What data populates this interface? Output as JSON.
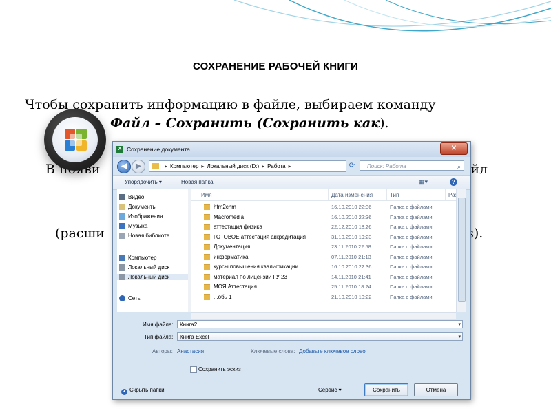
{
  "slide": {
    "title": "СОХРАНЕНИЕ РАБОЧЕЙ КНИГИ",
    "line1": "Чтобы сохранить информацию в файле, выбираем команду",
    "line2_emph": "Файл – Сохранить (Сохранить как",
    "line2_tail": ").",
    "line3_left": "В появи",
    "line3_right": "айл",
    "line4_left": "(расши",
    "line4_right": "ls)."
  },
  "dialog": {
    "title": "Сохранение документа",
    "close_icon": "✕",
    "path": [
      "Компьютер",
      "Локальный диск (D:)",
      "Работа"
    ],
    "search_placeholder": "Поиск: Работа",
    "toolbar": {
      "organize": "Упорядочить ▾",
      "new_folder": "Новая папка"
    },
    "nav_items": [
      "Видео",
      "Документы",
      "Изображения",
      "Музыка",
      "Новая библиоте",
      "Компьютер",
      "Локальный диск",
      "Локальный диск",
      "Сеть"
    ],
    "columns": {
      "name": "Имя",
      "date": "Дата изменения",
      "type": "Тип",
      "size": "Раз"
    },
    "files": [
      {
        "name": "htm2chm",
        "date": "16.10.2010 22:36",
        "type": "Папка с файлами"
      },
      {
        "name": "Macromedia",
        "date": "16.10.2010 22:36",
        "type": "Папка с файлами"
      },
      {
        "name": "аттестация физика",
        "date": "22.12.2010 18:26",
        "type": "Папка с файлами"
      },
      {
        "name": "ГОТОВОЕ аттестация аккредитация",
        "date": "31.10.2010 19:23",
        "type": "Папка с файлами"
      },
      {
        "name": "Документация",
        "date": "23.11.2010 22:58",
        "type": "Папка с файлами"
      },
      {
        "name": "информатика",
        "date": "07.11.2010 21:13",
        "type": "Папка с файлами"
      },
      {
        "name": "курсы повышения квалификации",
        "date": "16.10.2010 22:36",
        "type": "Папка с файлами"
      },
      {
        "name": "материал по лицензии ГУ 23",
        "date": "14.11.2010 21:41",
        "type": "Папка с файлами"
      },
      {
        "name": "МОЯ Аттестация",
        "date": "25.11.2010 18:24",
        "type": "Папка с файлами"
      },
      {
        "name": "...обь 1",
        "date": "21.10.2010 10:22",
        "type": "Папка с файлами"
      }
    ],
    "form": {
      "filename_label": "Имя файла:",
      "filename_value": "Книга2",
      "filetype_label": "Тип файла:",
      "filetype_value": "Книга Excel",
      "authors_label": "Авторы:",
      "authors_value": "Анастасия",
      "keywords_label": "Ключевые слова:",
      "keywords_value": "Добавьте ключевое слово",
      "thumbnail_label": "Сохранить эскиз",
      "hide_folders": "Скрыть папки",
      "tools": "Сервис ▾",
      "save": "Сохранить",
      "cancel": "Отмена"
    }
  },
  "colors": {
    "accent": "#2f67b6",
    "dialog_bg": "#d7e4f2",
    "folder": "#e6b84a",
    "deco": "#3fa7c9"
  }
}
